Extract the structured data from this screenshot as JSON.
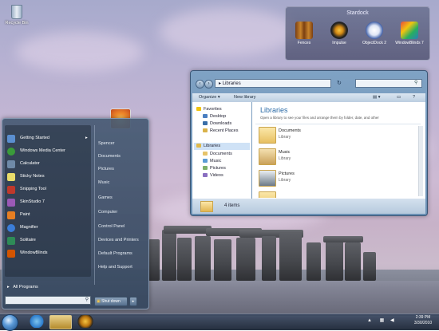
{
  "desktop": {
    "recycle_bin_label": "Recycle Bin"
  },
  "gadget": {
    "title": "Stardock",
    "items": [
      {
        "label": "Fences",
        "icon": "fences-icon",
        "color": "#c8842c"
      },
      {
        "label": "Impulse",
        "icon": "impulse-icon",
        "color": "#2c2c2c"
      },
      {
        "label": "ObjectDock 2",
        "icon": "objectdock-icon",
        "color": "#dfe6f5"
      },
      {
        "label": "WindowBlinds 7",
        "icon": "windowblinds-icon",
        "color": "#e8d9c2"
      }
    ]
  },
  "explorer": {
    "address": "Libraries",
    "toolbar": {
      "organize": "Organize ▾",
      "new_library": "New library"
    },
    "nav": {
      "favorites": "Favorites",
      "desktop": "Desktop",
      "downloads": "Downloads",
      "recent_places": "Recent Places",
      "libraries": "Libraries",
      "documents": "Documents",
      "music": "Music",
      "pictures": "Pictures",
      "videos": "Videos"
    },
    "main": {
      "title": "Libraries",
      "description": "Open a library to see your files and arrange them by folder, date, and other"
    },
    "libraries": [
      {
        "name": "Documents",
        "type": "Library"
      },
      {
        "name": "Music",
        "type": "Library"
      },
      {
        "name": "Pictures",
        "type": "Library"
      }
    ],
    "status": "4 items"
  },
  "start_menu": {
    "programs": [
      {
        "label": "Getting Started",
        "has_arrow": true,
        "color": "#5b8fd0"
      },
      {
        "label": "Windows Media Center",
        "color": "#3a9b3a"
      },
      {
        "label": "Calculator",
        "color": "#6f8aa8"
      },
      {
        "label": "Sticky Notes",
        "color": "#e9dc6a"
      },
      {
        "label": "Snipping Tool",
        "color": "#c0392b"
      },
      {
        "label": "SkinStudio 7",
        "color": "#9b59b6"
      },
      {
        "label": "Paint",
        "color": "#e67e22"
      },
      {
        "label": "Magnifier",
        "color": "#3b7dd8"
      },
      {
        "label": "Solitaire",
        "color": "#2e8b57"
      },
      {
        "label": "WindowBlinds",
        "color": "#d35400"
      }
    ],
    "arrow": "▸",
    "all_programs": "All Programs",
    "right_items": [
      "Spencer",
      "Documents",
      "Pictures",
      "Music",
      "Games",
      "Computer",
      "Control Panel",
      "Devices and Printers",
      "Default Programs",
      "Help and Support"
    ],
    "shutdown": "Shut down"
  },
  "taskbar": {
    "time": "2:39 PM",
    "date": "3/30/2010"
  }
}
